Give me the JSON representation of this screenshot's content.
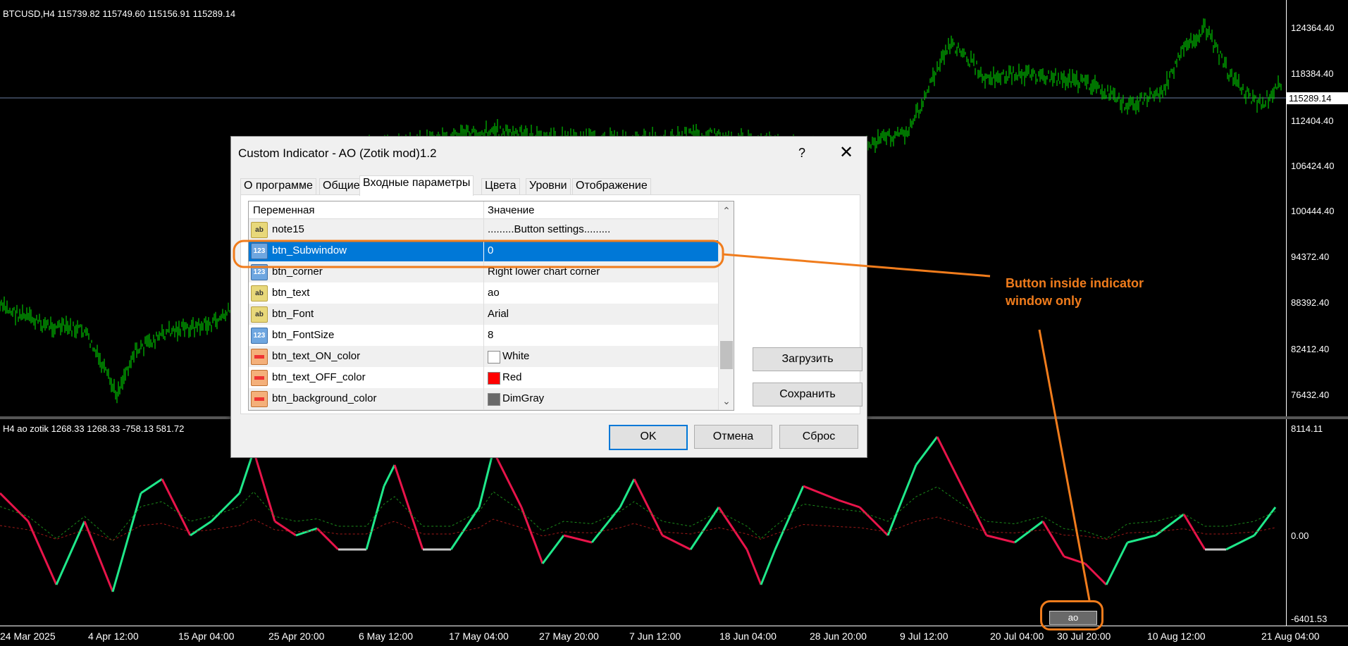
{
  "chart": {
    "symbol_header": "BTCUSD,H4  115739.82 115749.60 115156.91 115289.14",
    "indicator_header": "H4 ao zotik  1268.33 1268.33 -758.13 581.72",
    "price_labels": [
      "124364.40",
      "118384.40",
      "112404.40",
      "106424.40",
      "100444.40",
      "94372.40",
      "88392.40",
      "82412.40",
      "76432.40"
    ],
    "current_price": "115289.14",
    "indicator_labels": [
      "8114.11",
      "0.00",
      "-6401.53"
    ],
    "time_labels": [
      "24 Mar 2025",
      "4 Apr 12:00",
      "15 Apr 04:00",
      "25 Apr 20:00",
      "6 May 12:00",
      "17 May 04:00",
      "27 May 20:00",
      "7 Jun 12:00",
      "18 Jun 04:00",
      "28 Jun 20:00",
      "9 Jul 12:00",
      "20 Jul 04:00",
      "30 Jul 20:00",
      "10 Aug 12:00",
      "21 Aug 04:00"
    ],
    "colors": {
      "candles": "#00c000",
      "ao_up": "#1fe88a",
      "ao_down": "#e8144a",
      "ao_neutral": "#c8c8c8",
      "ma_green": "#1a8a1a",
      "ma_red": "#a01818",
      "annotation": "#f07c1c"
    }
  },
  "dialog": {
    "title": "Custom Indicator - AO (Zotik mod)1.2",
    "help": "?",
    "close": "✕",
    "tabs": [
      "О программе",
      "Общие",
      "Входные параметры",
      "Цвета",
      "Уровни",
      "Отображение"
    ],
    "active_tab": "Входные параметры",
    "columns": {
      "variable": "Переменная",
      "value": "Значение"
    },
    "rows": [
      {
        "name": "note15",
        "value": ".........Button settings.........",
        "icon": "ab"
      },
      {
        "name": "btn_Subwindow",
        "value": "0",
        "icon": "123"
      },
      {
        "name": "btn_corner",
        "value": "Right lower chart corner",
        "icon": "123"
      },
      {
        "name": "btn_text",
        "value": "ao",
        "icon": "ab"
      },
      {
        "name": "btn_Font",
        "value": "Arial",
        "icon": "ab"
      },
      {
        "name": "btn_FontSize",
        "value": "8",
        "icon": "123"
      },
      {
        "name": "btn_text_ON_color",
        "value": "White",
        "icon": "color",
        "swatch": "#ffffff"
      },
      {
        "name": "btn_text_OFF_color",
        "value": "Red",
        "icon": "color",
        "swatch": "#ff0000"
      },
      {
        "name": "btn_background_color",
        "value": "DimGray",
        "icon": "color",
        "swatch": "#696969"
      }
    ],
    "load_button": "Загрузить",
    "save_button": "Сохранить",
    "ok_button": "OK",
    "cancel_button": "Отмена",
    "reset_button": "Сброс"
  },
  "annotation": {
    "line1": "Button inside indicator",
    "line2": "window only"
  },
  "chart_button": "ao"
}
